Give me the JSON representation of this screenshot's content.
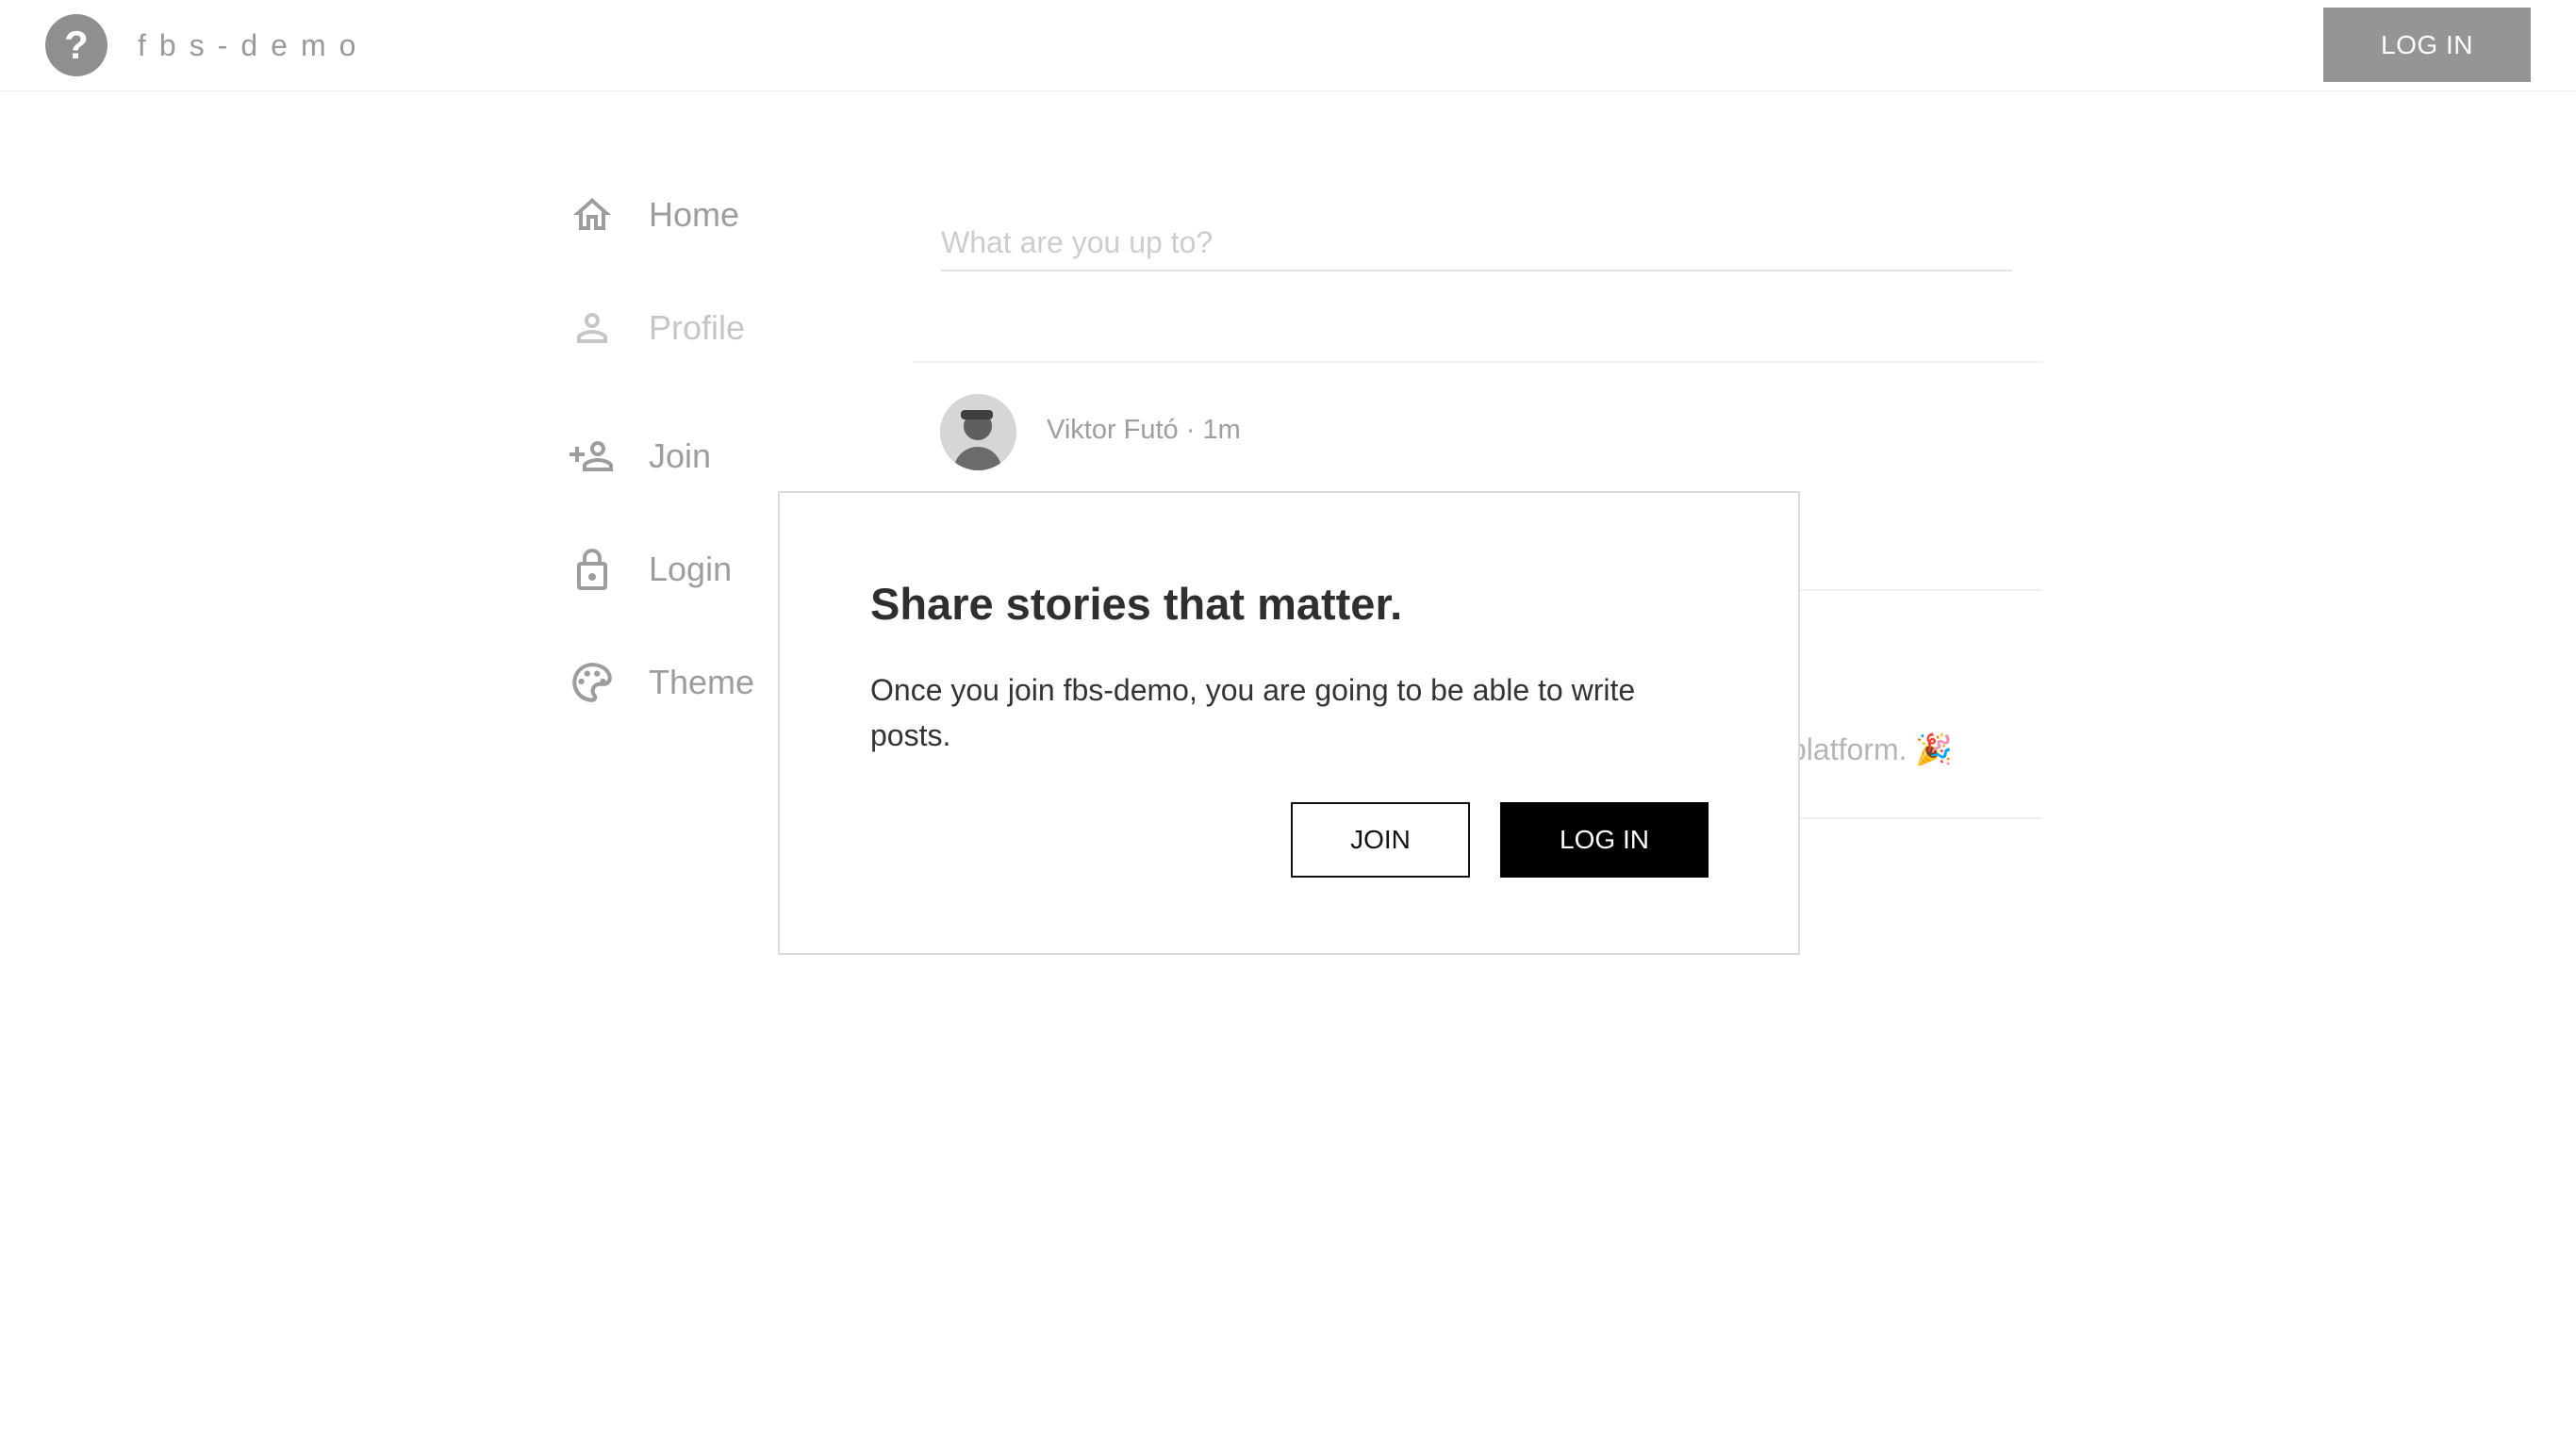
{
  "header": {
    "brand": "fbs-demo",
    "login_label": "LOG IN",
    "logo_icon": "question-circle-icon"
  },
  "sidebar": {
    "items": [
      {
        "label": "Home",
        "icon": "home-icon"
      },
      {
        "label": "Profile",
        "icon": "person-icon"
      },
      {
        "label": "Join",
        "icon": "person-add-icon"
      },
      {
        "label": "Login",
        "icon": "lock-icon"
      },
      {
        "label": "Theme",
        "icon": "palette-icon"
      }
    ]
  },
  "composer": {
    "placeholder": "What are you up to?"
  },
  "post": {
    "author_meta": "Viktor Futó · 1m",
    "text_fragment": "platform. 🎉"
  },
  "modal": {
    "title": "Share stories that matter.",
    "body": "Once you join fbs-demo, you are going to be able to write posts.",
    "join_label": "JOIN",
    "login_label": "LOG IN"
  },
  "colors": {
    "header_button": "#959595",
    "primary_button": "#000000",
    "nav_text": "#9d9d9d"
  }
}
